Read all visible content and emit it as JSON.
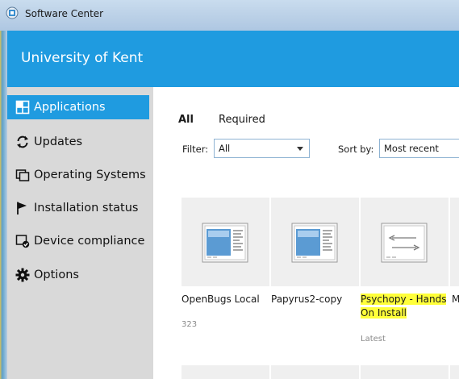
{
  "window": {
    "title": "Software Center"
  },
  "header": {
    "org": "University of Kent"
  },
  "sidebar": {
    "items": [
      {
        "label": "Applications",
        "icon": "grid-icon",
        "active": true
      },
      {
        "label": "Updates",
        "icon": "refresh-icon"
      },
      {
        "label": "Operating Systems",
        "icon": "windows-icon"
      },
      {
        "label": "Installation status",
        "icon": "flag-icon"
      },
      {
        "label": "Device compliance",
        "icon": "shield-check-icon"
      },
      {
        "label": "Options",
        "icon": "gear-icon"
      }
    ]
  },
  "main": {
    "tabs": [
      {
        "label": "All",
        "active": true
      },
      {
        "label": "Required"
      }
    ],
    "filter": {
      "label": "Filter:",
      "value": "All"
    },
    "sort": {
      "label": "Sort by:",
      "value": "Most recent"
    },
    "apps": [
      {
        "name": "OpenBugs Local",
        "meta": "323",
        "icon": "application-window-icon"
      },
      {
        "name": "Papyrus2-copy",
        "meta": "",
        "icon": "application-window-icon"
      },
      {
        "name_line1": "Psychopy - Hands",
        "name_line2": "On Install",
        "meta": "Latest",
        "icon": "script-document-icon",
        "highlight": "#ffff3a"
      },
      {
        "name": "M",
        "meta": ""
      }
    ]
  },
  "colors": {
    "accent": "#1f9be0",
    "sidebar": "#d9d9d9",
    "tile": "#efefef",
    "highlight": "#ffff3a"
  }
}
